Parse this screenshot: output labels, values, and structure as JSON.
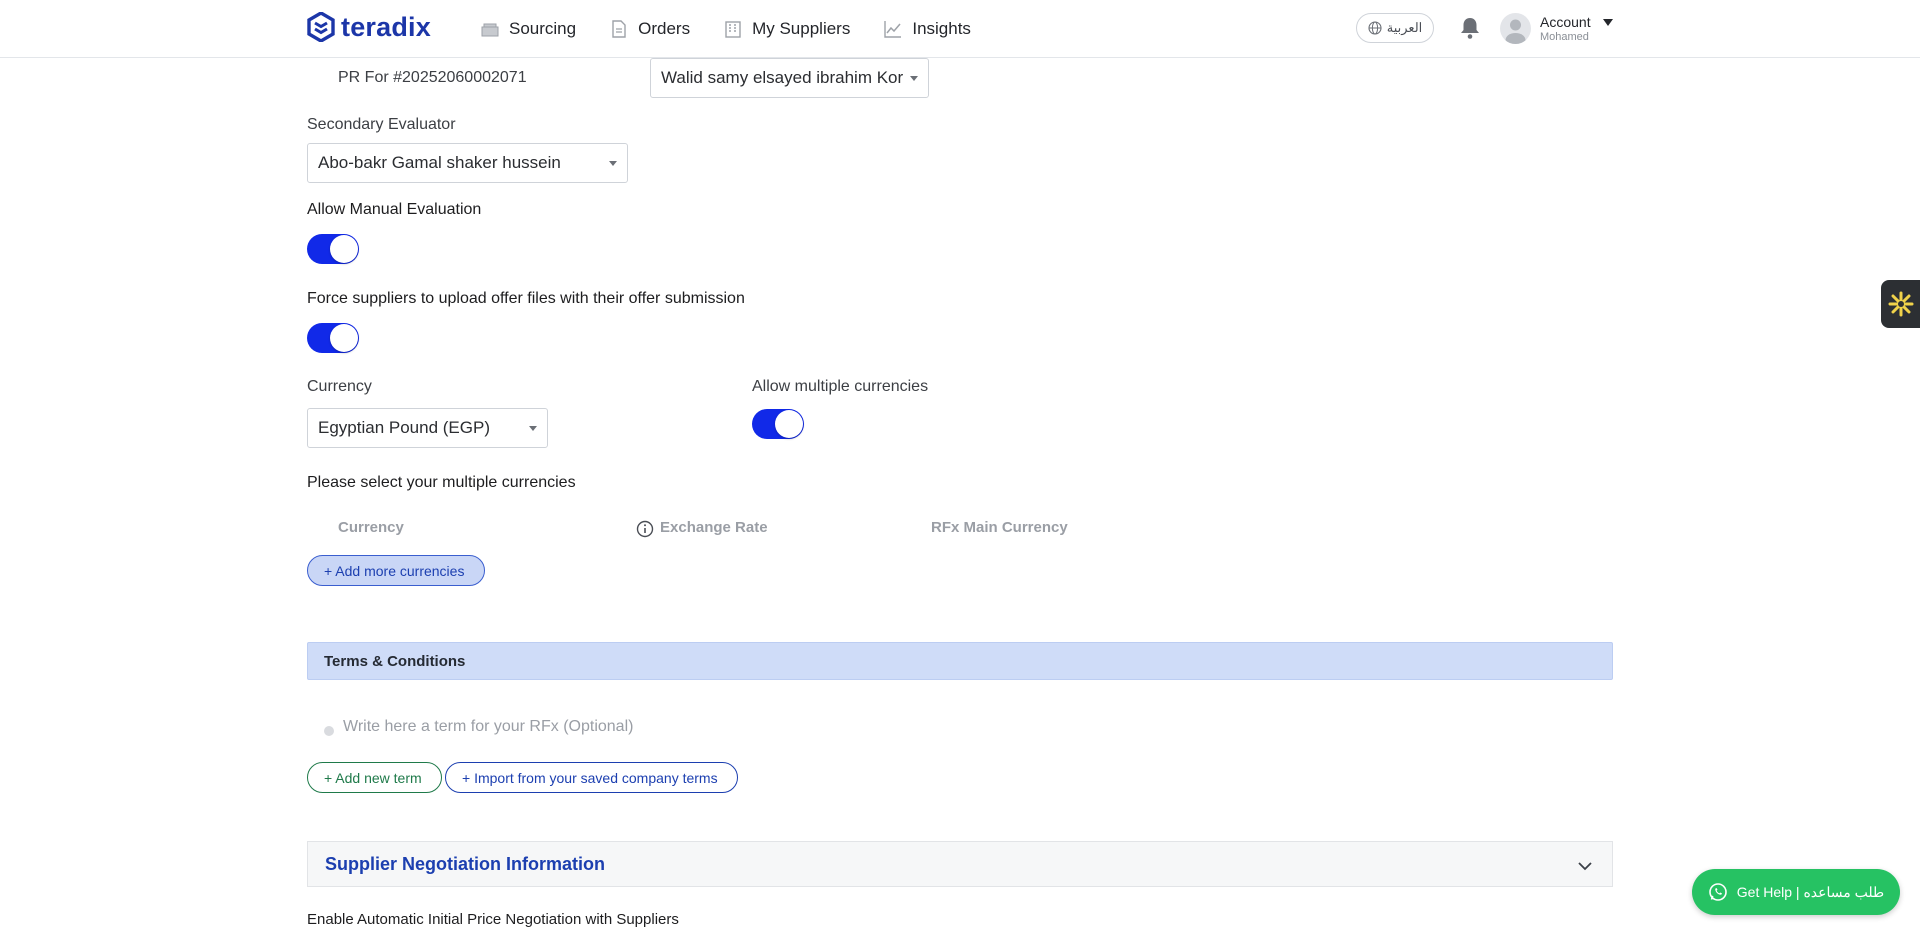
{
  "header": {
    "brand": "teradix",
    "nav": [
      {
        "label": "Sourcing",
        "icon": "sourcing-icon"
      },
      {
        "label": "Orders",
        "icon": "orders-icon"
      },
      {
        "label": "My Suppliers",
        "icon": "suppliers-icon"
      },
      {
        "label": "Insights",
        "icon": "insights-icon"
      }
    ],
    "language_label": "العربية",
    "account_label": "Account",
    "account_user": "Mohamed"
  },
  "form": {
    "pr_label": "PR For #20252060002071",
    "pr_evaluator_value": "Walid samy elsayed ibrahim Kor",
    "secondary_evaluator_label": "Secondary Evaluator",
    "secondary_evaluator_value": "Abo-bakr Gamal shaker hussein",
    "allow_manual_label": "Allow Manual Evaluation",
    "allow_manual_on": true,
    "force_upload_label": "Force suppliers to upload offer files with their offer submission",
    "force_upload_on": true,
    "currency_label": "Currency",
    "currency_value": "Egyptian Pound (EGP)",
    "multi_currency_label": "Allow multiple currencies",
    "multi_currency_on": true,
    "multi_select_label": "Please select your multiple currencies",
    "table_headers": [
      "Currency",
      "Exchange Rate",
      "RFx Main Currency"
    ],
    "add_currencies_label": "+ Add more currencies"
  },
  "terms": {
    "title": "Terms & Conditions",
    "placeholder": "Write here a term for your RFx (Optional)",
    "add_term_label": "+ Add new term",
    "import_label": "+ Import from your saved company terms"
  },
  "negotiation": {
    "title": "Supplier Negotiation Information",
    "auto_label": "Enable Automatic Initial Price Negotiation with Suppliers"
  },
  "help": {
    "label": "Get Help | طلب مساعده"
  },
  "colors": {
    "brand": "#1c36a8",
    "toggle_on": "#1129e8",
    "section_bar": "#cfdcf8",
    "help_green": "#26c263"
  }
}
